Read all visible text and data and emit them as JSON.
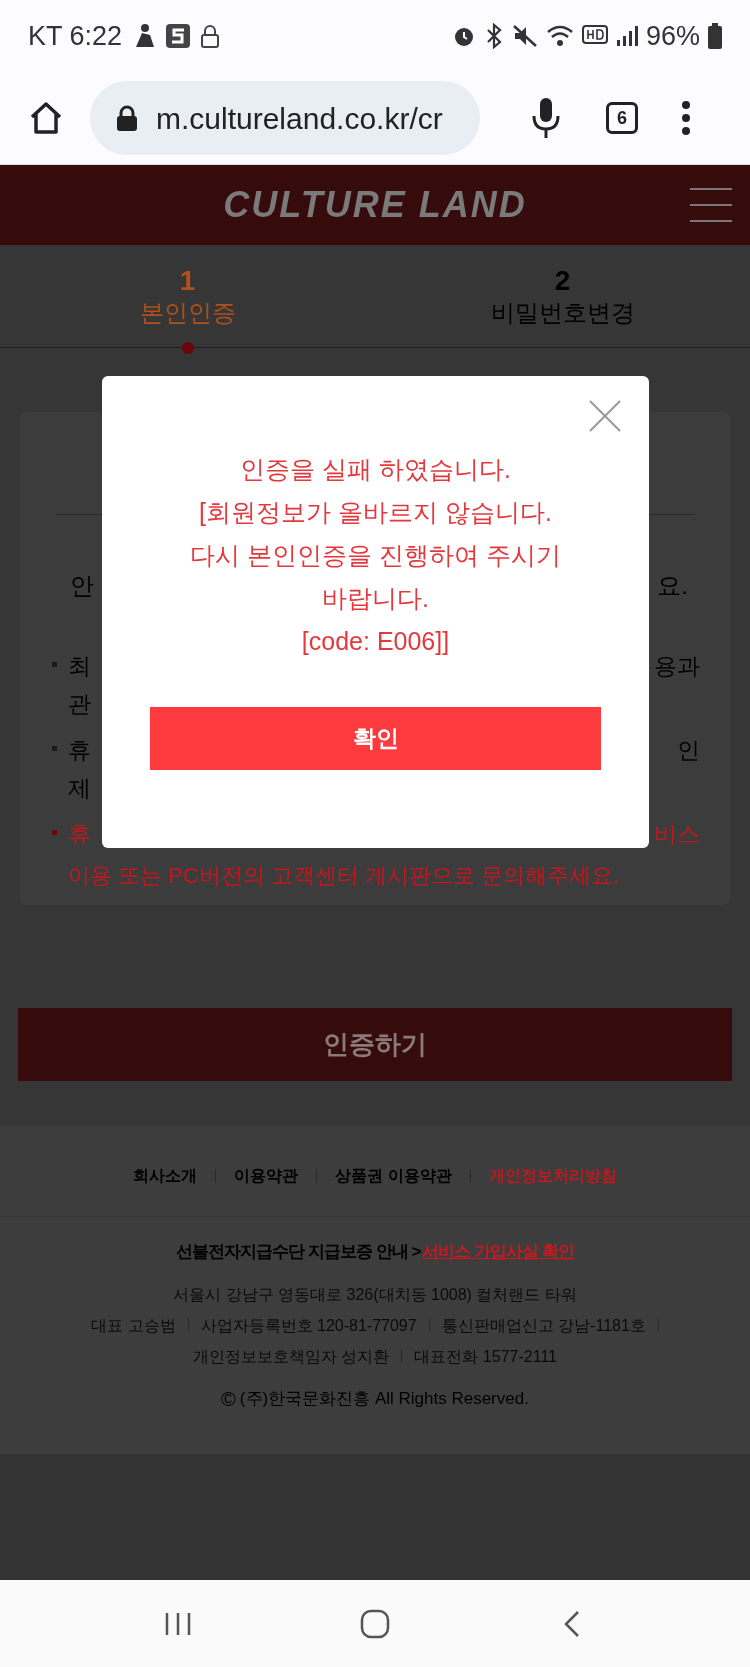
{
  "status_bar": {
    "carrier_time": "KT 6:22",
    "battery": "96%"
  },
  "browser": {
    "url": "m.cultureland.co.kr/cr",
    "tab_count": "6"
  },
  "header": {
    "logo": "CULTURE LAND"
  },
  "steps": [
    {
      "number": "1",
      "label": "본인인증",
      "selected": true
    },
    {
      "number": "2",
      "label": "비밀번호변경",
      "selected": false
    }
  ],
  "card": {
    "lines": [
      {
        "kind": "intro",
        "left": "안",
        "right": "요."
      },
      {
        "kind": "bullet",
        "left": "최",
        "right": "용과"
      },
      {
        "kind": "cont",
        "left": "관"
      },
      {
        "kind": "bullet",
        "left": "휴",
        "right": "인"
      },
      {
        "kind": "cont",
        "left": "제"
      },
      {
        "kind": "warn",
        "left": "휴",
        "right": "비스"
      },
      {
        "kind": "warncont",
        "left": "이용 또는 PC버전의 고객센터 게시판으로 문의해주세요."
      }
    ]
  },
  "submit_button": "인증하기",
  "footer": {
    "links": [
      {
        "label": "회사소개",
        "highlight": false
      },
      {
        "label": "이용약관",
        "highlight": false
      },
      {
        "label": "상품권 이용약관",
        "highlight": false
      },
      {
        "label": "개인정보처리방침",
        "highlight": true
      }
    ],
    "guarantee": {
      "text": "선불전자지급수단 지급보증 안내 >",
      "link": "서비스 가입사실 확인"
    },
    "address_lines": [
      {
        "items": [
          "서울시 강남구 영동대로 326(대치동 1008) 컬처랜드 타워"
        ],
        "trailing_separator": false
      },
      {
        "items": [
          "대표 고승범",
          "사업자등록번호 120-81-77097",
          "통신판매업신고 강남-1181호"
        ],
        "trailing_separator": true
      },
      {
        "items": [
          "개인정보보호책임자 성지환",
          "대표전화 1577-2111"
        ],
        "trailing_separator": false
      }
    ],
    "copyright_mark": "©",
    "copyright": "(주)한국문화진흥 All Rights Reserved."
  },
  "dialog": {
    "message": [
      "인증을 실패 하였습니다.",
      "[회원정보가 올바르지 않습니다.",
      "다시 본인인증을 진행하여 주시기",
      "바랍니다.",
      "[code: E006]]"
    ],
    "confirm": "확인"
  }
}
